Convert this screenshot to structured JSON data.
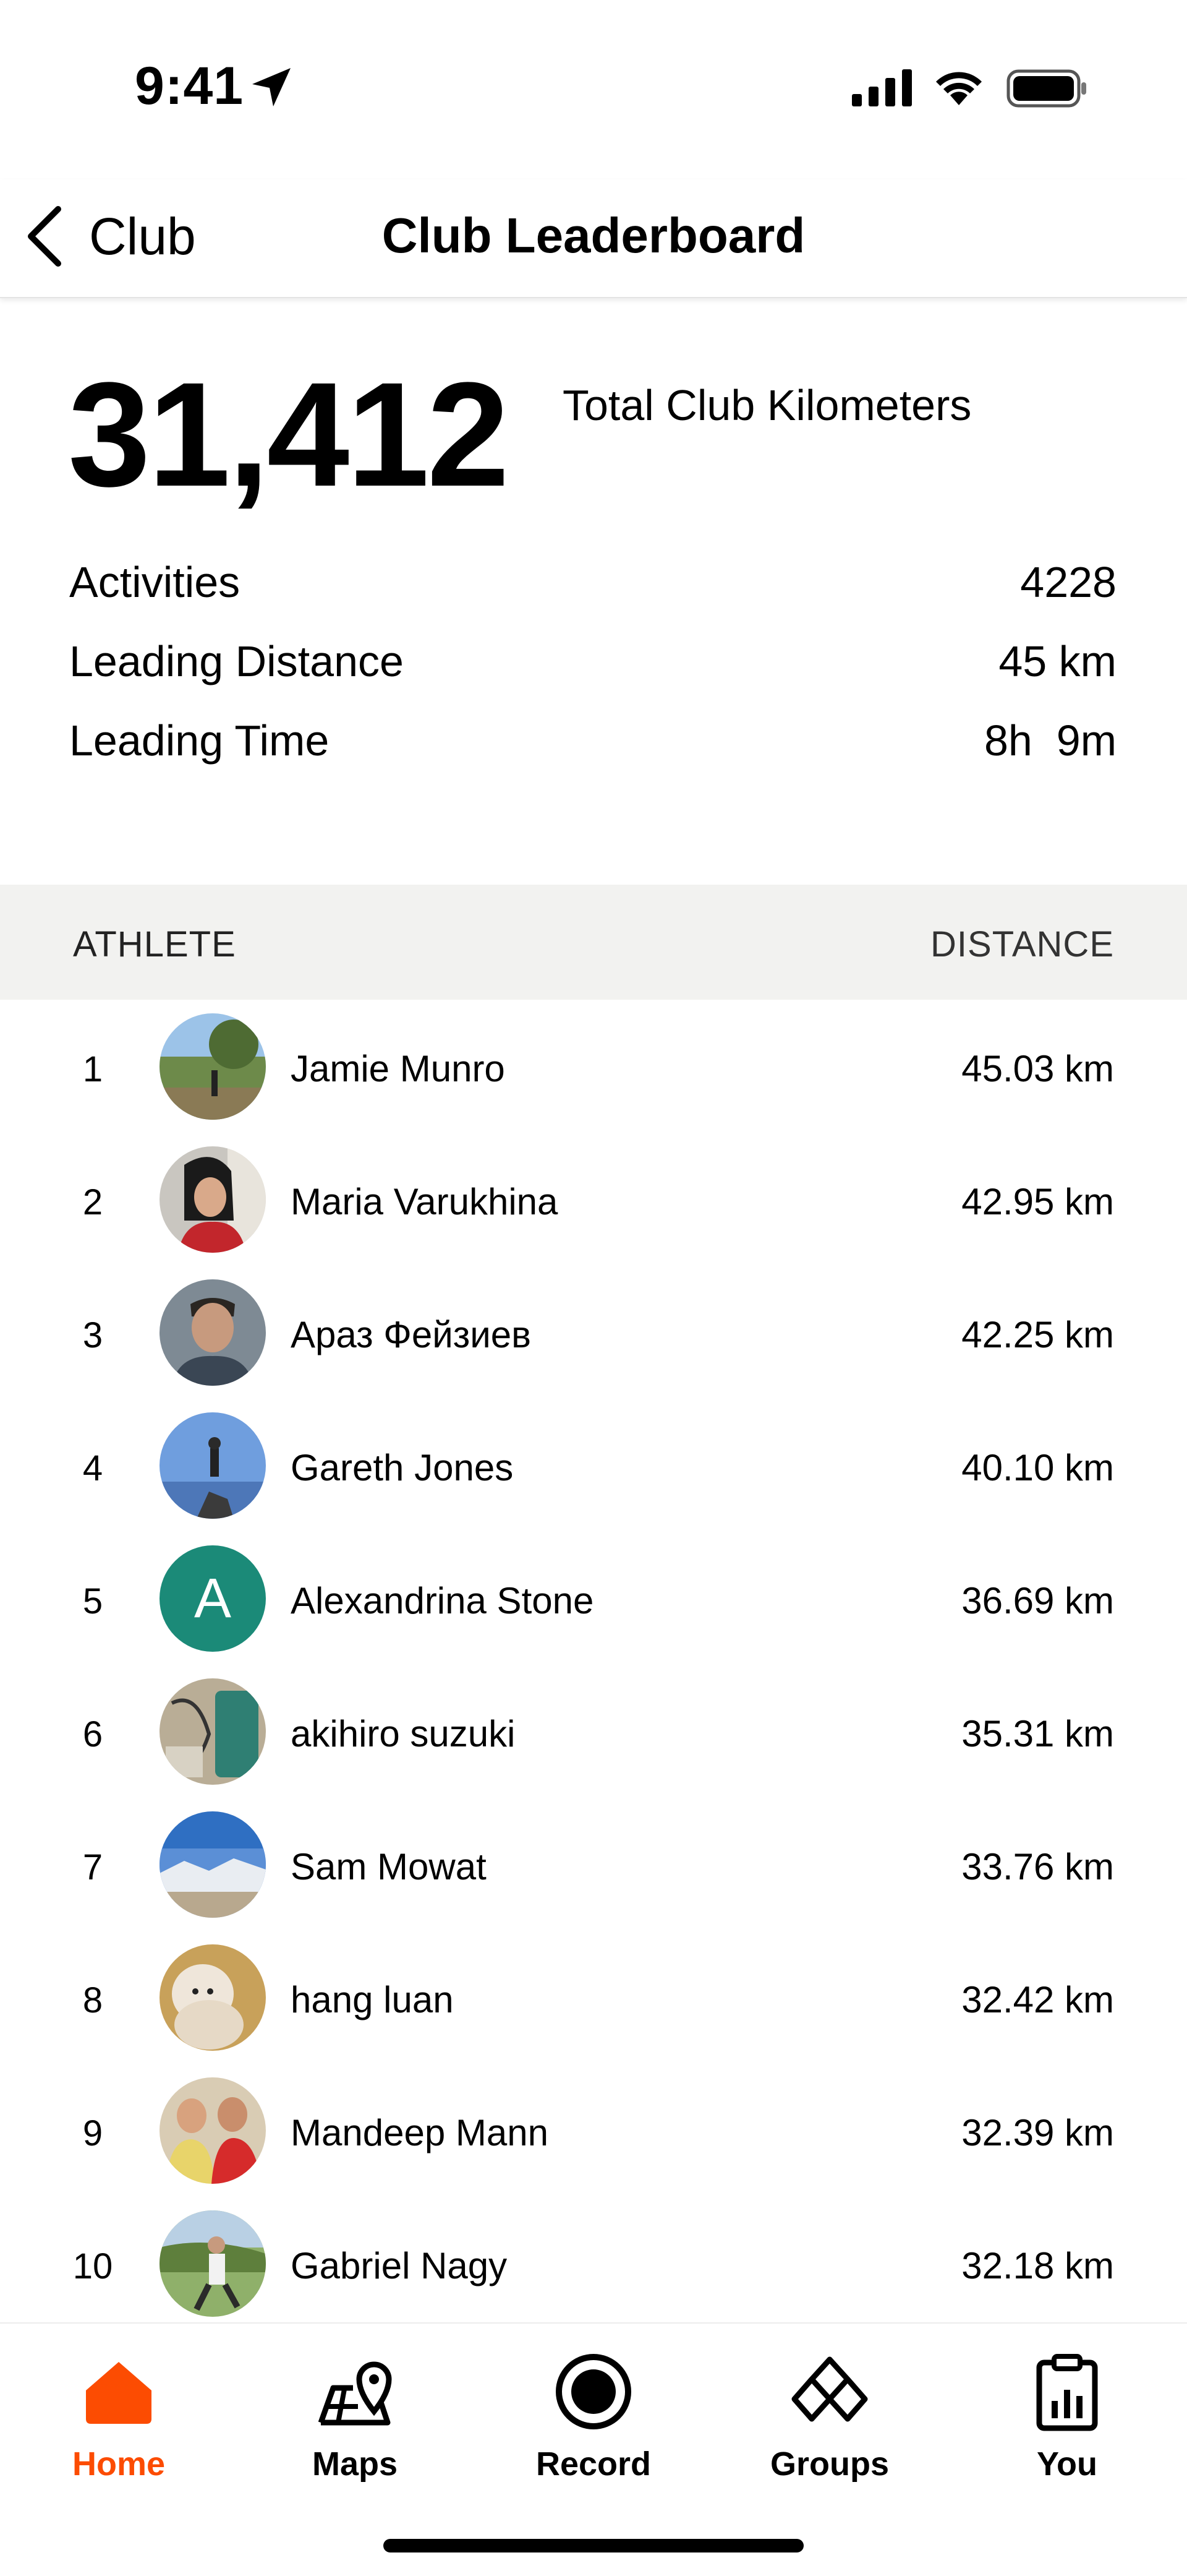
{
  "status_bar": {
    "time": "9:41"
  },
  "nav": {
    "back_label": "Club",
    "title": "Club Leaderboard"
  },
  "summary": {
    "total_value": "31,412",
    "total_label": "Total Club Kilometers",
    "stats": [
      {
        "label": "Activities",
        "value": "4228"
      },
      {
        "label": "Leading Distance",
        "value": "45 km"
      },
      {
        "label": "Leading Time",
        "value": "8h  9m"
      }
    ]
  },
  "table": {
    "col_athlete": "ATHLETE",
    "col_distance": "DISTANCE",
    "rows": [
      {
        "rank": "1",
        "name": "Jamie Munro",
        "distance": "45.03 km"
      },
      {
        "rank": "2",
        "name": "Maria Varukhina",
        "distance": "42.95 km"
      },
      {
        "rank": "3",
        "name": "Араз Фейзиев",
        "distance": "42.25 km"
      },
      {
        "rank": "4",
        "name": "Gareth Jones",
        "distance": "40.10 km"
      },
      {
        "rank": "5",
        "name": "Alexandrina Stone",
        "distance": "36.69 km",
        "initial": "A"
      },
      {
        "rank": "6",
        "name": "akihiro suzuki",
        "distance": "35.31 km"
      },
      {
        "rank": "7",
        "name": "Sam Mowat",
        "distance": "33.76 km"
      },
      {
        "rank": "8",
        "name": "hang luan",
        "distance": "32.42 km"
      },
      {
        "rank": "9",
        "name": "Mandeep Mann",
        "distance": "32.39 km"
      },
      {
        "rank": "10",
        "name": "Gabriel Nagy",
        "distance": "32.18 km"
      }
    ]
  },
  "tabbar": {
    "tabs": [
      {
        "label": "Home",
        "icon": "home-icon",
        "active": true
      },
      {
        "label": "Maps",
        "icon": "map-icon"
      },
      {
        "label": "Record",
        "icon": "record-icon"
      },
      {
        "label": "Groups",
        "icon": "groups-icon"
      },
      {
        "label": "You",
        "icon": "profile-icon"
      }
    ]
  },
  "colors": {
    "accent": "#fc4c02",
    "avatar_initial_bg": "#1b8a78",
    "header_bg": "#f2f2f0"
  }
}
